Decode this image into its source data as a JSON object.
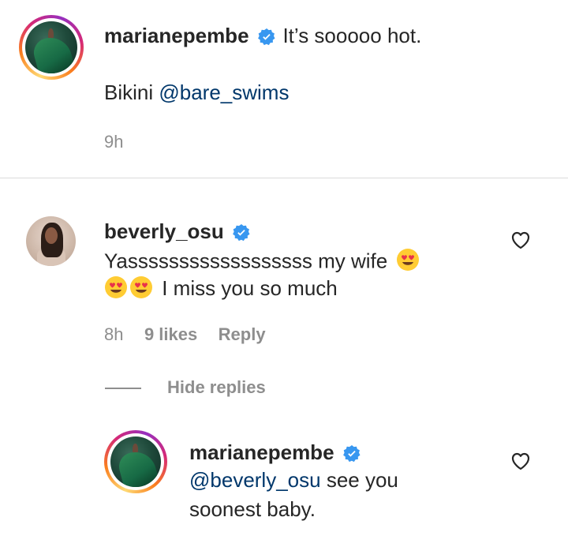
{
  "caption": {
    "username": "marianepembe",
    "text": "It’s sooooo hot.",
    "line2_prefix": "Bikini ",
    "mention": "@bare_swims",
    "time": "9h"
  },
  "comment": {
    "username": "beverly_osu",
    "text_line1": "Yassssssssssssssssss my wife",
    "text_line2": "I miss you so much",
    "time": "8h",
    "likes": "9 likes",
    "reply_label": "Reply",
    "hide_replies_label": "Hide replies"
  },
  "reply": {
    "username": "marianepembe",
    "mention": "@beverly_osu",
    "text_line1_rest": " see you",
    "text_line2": "soonest baby."
  },
  "colors": {
    "verified": "#3897f0",
    "mention": "#00376b",
    "meta": "#8e8e8e",
    "text": "#262626"
  },
  "icons": {
    "verified": "verified-badge-icon",
    "heart": "heart-outline-icon",
    "emoji": "heart-eyes-emoji"
  }
}
